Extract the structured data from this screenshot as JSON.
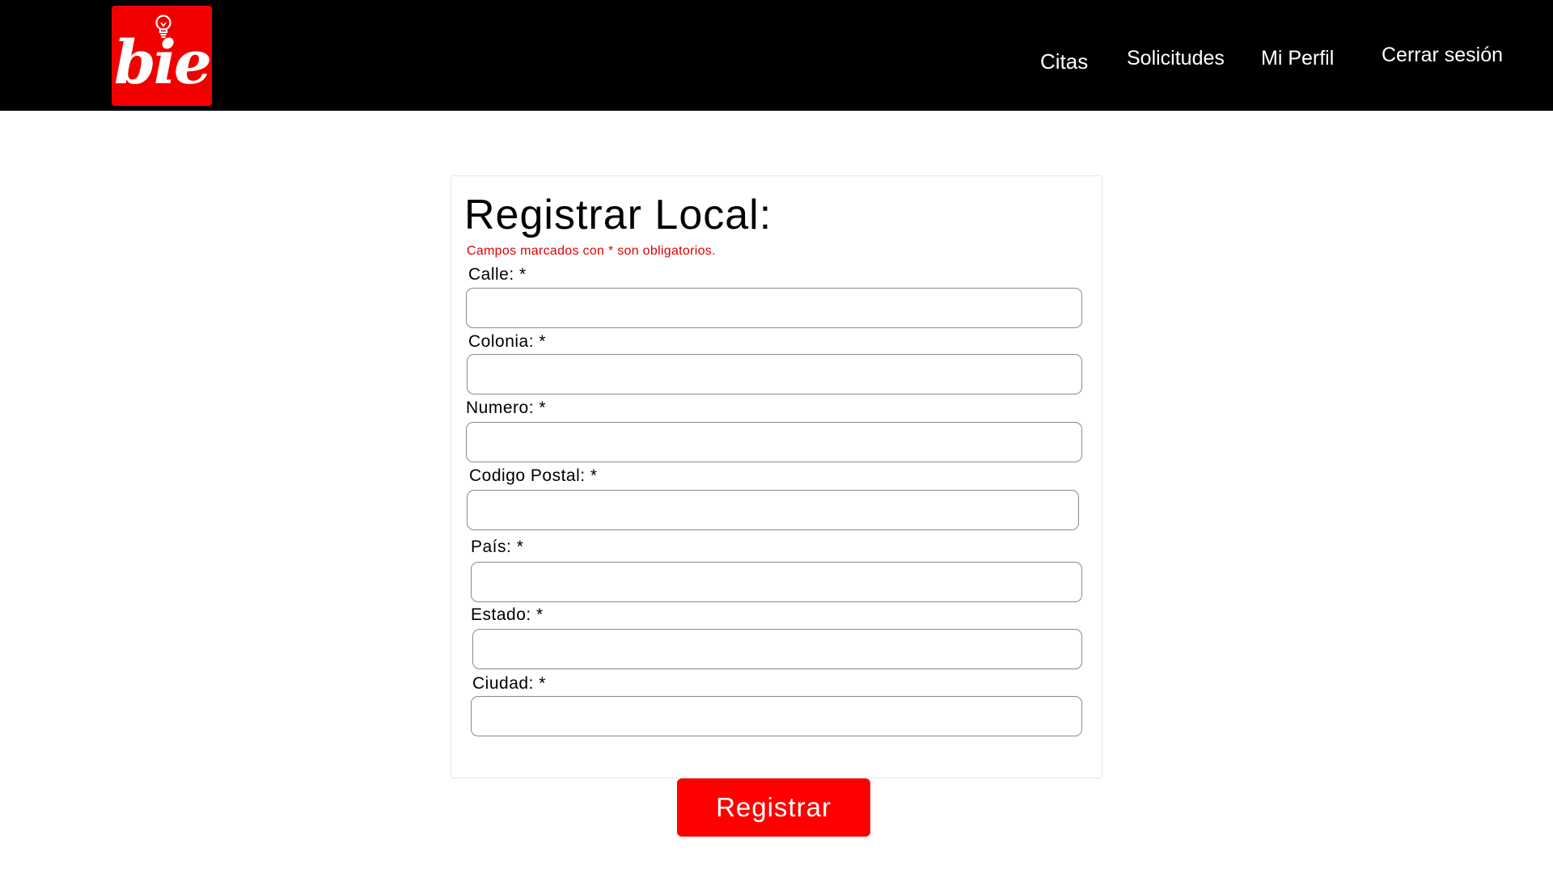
{
  "brand": {
    "logo_text": "bie",
    "icon": "lightbulb-icon",
    "color": "#f20000"
  },
  "nav": {
    "citas": "Citas",
    "solicitudes": "Solicitudes",
    "mi_perfil": "Mi Perfil",
    "cerrar_sesion": "Cerrar sesión"
  },
  "form": {
    "title": "Registrar Local:",
    "required_note": "Campos marcados con * son obligatorios.",
    "fields": [
      {
        "label": "Calle: *",
        "value": ""
      },
      {
        "label": "Colonia: *",
        "value": ""
      },
      {
        "label": "Numero: *",
        "value": ""
      },
      {
        "label": "Codigo Postal: *",
        "value": ""
      },
      {
        "label": "País: *",
        "value": ""
      },
      {
        "label": "Estado: *",
        "value": ""
      },
      {
        "label": "Ciudad: *",
        "value": ""
      }
    ],
    "submit_label": "Registrar"
  },
  "colors": {
    "accent": "#ff0000",
    "navbar": "#000000",
    "note": "#e00000"
  }
}
